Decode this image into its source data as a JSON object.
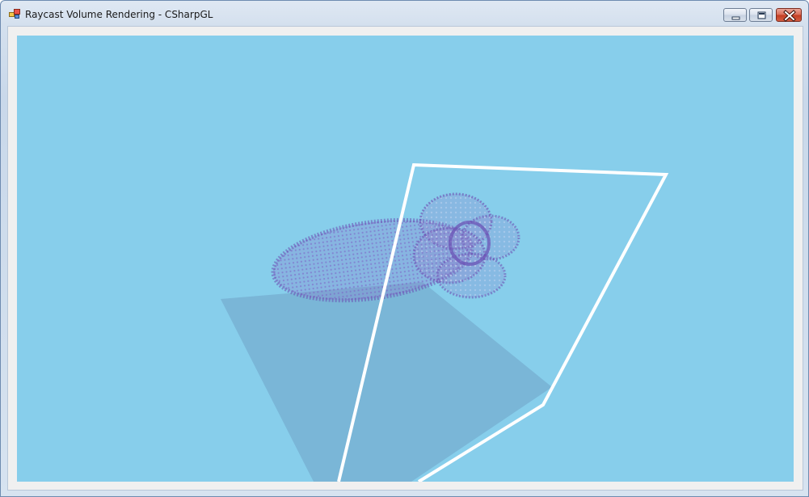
{
  "window": {
    "title": "Raycast Volume Rendering - CSharpGL",
    "icon": "app-window-icon"
  },
  "caption_buttons": {
    "minimize": "minimize-icon",
    "maximize": "maximize-icon",
    "close": "close-icon"
  },
  "viewport": {
    "background": "#87ceeb",
    "content": "opengl-render-canvas"
  },
  "colors": {
    "volume": "#6a4fb3",
    "bounding_box": "#ffffff",
    "shadow": "#6fa3c6"
  }
}
